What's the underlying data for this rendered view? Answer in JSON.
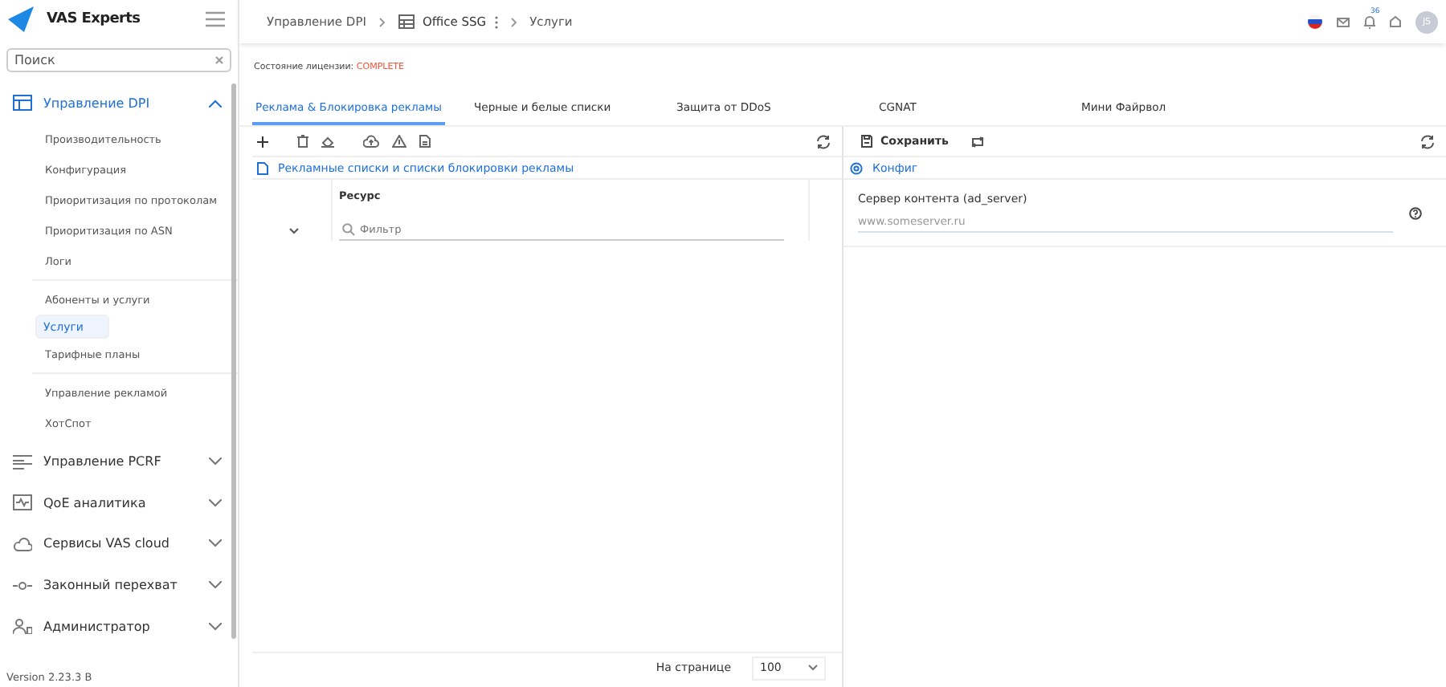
{
  "brand": {
    "name": "VAS Experts"
  },
  "search": {
    "value": "Поиск"
  },
  "sidebar": {
    "groups": [
      {
        "label": "Управление DPI",
        "expanded": true,
        "sections": [
          [
            {
              "label": "Производительность",
              "selected": false
            },
            {
              "label": "Конфигурация",
              "selected": false
            },
            {
              "label": "Приоритизация по протоколам",
              "selected": false
            },
            {
              "label": "Приоритизация по ASN",
              "selected": false
            },
            {
              "label": "Логи",
              "selected": false
            }
          ],
          [
            {
              "label": "Абоненты и услуги",
              "selected": false
            },
            {
              "label": "Услуги",
              "selected": true
            },
            {
              "label": "Тарифные планы",
              "selected": false
            }
          ],
          [
            {
              "label": "Управление рекламой",
              "selected": false
            },
            {
              "label": "ХотСпот",
              "selected": false
            }
          ]
        ]
      },
      {
        "label": "Управление PCRF",
        "expanded": false
      },
      {
        "label": "QoE аналитика",
        "expanded": false
      },
      {
        "label": "Сервисы VAS cloud",
        "expanded": false
      },
      {
        "label": "Законный перехват",
        "expanded": false
      },
      {
        "label": "Администратор",
        "expanded": false
      }
    ]
  },
  "version": "Version 2.23.3 B",
  "breadcrumbs": [
    "Управление DPI",
    "Office SSG",
    "Услуги"
  ],
  "header": {
    "notifications": "36",
    "avatar": "JS"
  },
  "license": {
    "label": "Состояние лицензии:",
    "status": "COMPLETE"
  },
  "tabs": [
    {
      "label": "Реклама & Блокировка рекламы",
      "selected": true
    },
    {
      "label": "Черные и белые списки",
      "selected": false
    },
    {
      "label": "Защита от DDoS",
      "selected": false
    },
    {
      "label": "CGNAT",
      "selected": false
    },
    {
      "label": "Мини Файрвол",
      "selected": false
    }
  ],
  "left_panel": {
    "title": "Рекламные списки и списки блокировки рекламы",
    "column": "Ресурс",
    "filter_placeholder": "Фильтр"
  },
  "right_panel": {
    "save": "Сохранить",
    "title": "Конфиг",
    "field_label": "Сервер контента (ad_server)",
    "field_placeholder": "www.someserver.ru"
  },
  "pagination": {
    "label": "На странице",
    "value": "100"
  }
}
